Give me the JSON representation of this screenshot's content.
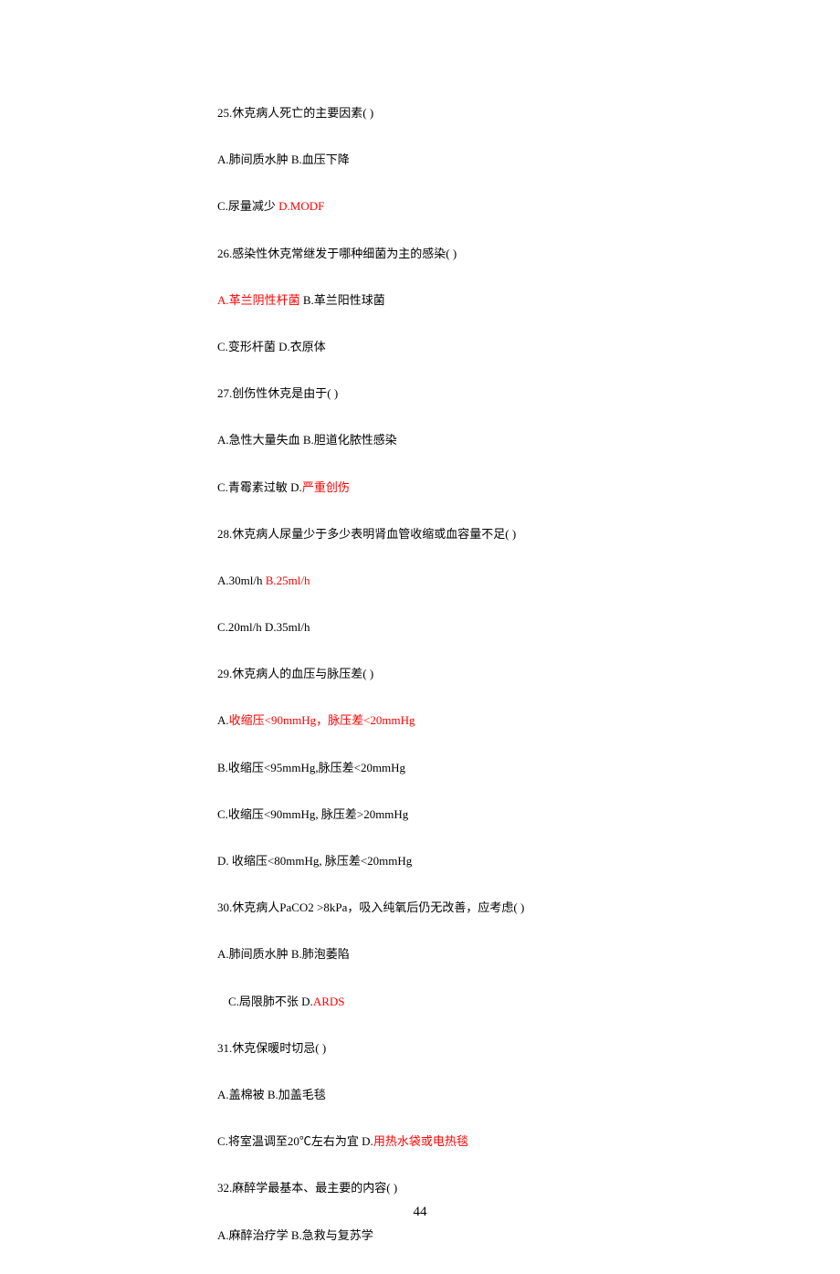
{
  "lines": [
    {
      "segs": [
        {
          "t": "25.休克病人死亡的主要因素( )"
        }
      ]
    },
    {
      "segs": [
        {
          "t": "A.肺间质水肿 B.血压下降"
        }
      ]
    },
    {
      "segs": [
        {
          "t": "C.尿量减少 "
        },
        {
          "t": "D.MODF",
          "hl": true
        }
      ]
    },
    {
      "segs": [
        {
          "t": "26.感染性休克常继发于哪种细菌为主的感染( )"
        }
      ]
    },
    {
      "segs": [
        {
          "t": "A.革兰阴性杆菌",
          "hl": true
        },
        {
          "t": " B.革兰阳性球菌"
        }
      ]
    },
    {
      "segs": [
        {
          "t": "C.变形杆菌 D.衣原体"
        }
      ]
    },
    {
      "segs": [
        {
          "t": "27.创伤性休克是由于( )"
        }
      ]
    },
    {
      "segs": [
        {
          "t": "A.急性大量失血 B.胆道化脓性感染"
        }
      ]
    },
    {
      "segs": [
        {
          "t": "C.青霉素过敏 D."
        },
        {
          "t": "严重创伤",
          "hl": true
        }
      ]
    },
    {
      "segs": [
        {
          "t": "28.休克病人尿量少于多少表明肾血管收缩或血容量不足( )"
        }
      ]
    },
    {
      "segs": [
        {
          "t": "A.30ml/h "
        },
        {
          "t": "B.25ml/h",
          "hl": true
        }
      ]
    },
    {
      "segs": [
        {
          "t": "C.20ml/h D.35ml/h"
        }
      ]
    },
    {
      "segs": [
        {
          "t": "29.休克病人的血压与脉压差( )"
        }
      ]
    },
    {
      "segs": [
        {
          "t": "A."
        },
        {
          "t": "收缩压<90mmHg，脉压差<20mmHg",
          "hl": true
        }
      ]
    },
    {
      "segs": [
        {
          "t": "B.收缩压<95mmHg,脉压差<20mmHg"
        }
      ]
    },
    {
      "segs": [
        {
          "t": "C.收缩压<90mmHg, 脉压差>20mmHg"
        }
      ]
    },
    {
      "segs": [
        {
          "t": "D. 收缩压<80mmHg, 脉压差<20mmHg"
        }
      ]
    },
    {
      "segs": [
        {
          "t": "30.休克病人PaCO2 >8kPa，吸入纯氧后仍无改善，应考虑( )"
        }
      ]
    },
    {
      "segs": [
        {
          "t": "A.肺间质水肿 B.肺泡萎陷"
        }
      ]
    },
    {
      "segs": [
        {
          "t": "C.局限肺不张 D."
        },
        {
          "t": "ARDS",
          "hl": true
        }
      ],
      "indent": true
    },
    {
      "segs": [
        {
          "t": "31.休克保暖时切忌( )"
        }
      ]
    },
    {
      "segs": [
        {
          "t": "A.盖棉被 B.加盖毛毯"
        }
      ]
    },
    {
      "segs": [
        {
          "t": "C.将室温调至20℃左右为宜 D."
        },
        {
          "t": "用热水袋或电热毯",
          "hl": true
        }
      ]
    },
    {
      "segs": [
        {
          "t": "32.麻醉学最基本、最主要的内容( )"
        }
      ]
    },
    {
      "segs": [
        {
          "t": "A.麻醉治疗学 B.急救与复苏学"
        }
      ]
    }
  ],
  "page_number": "44"
}
